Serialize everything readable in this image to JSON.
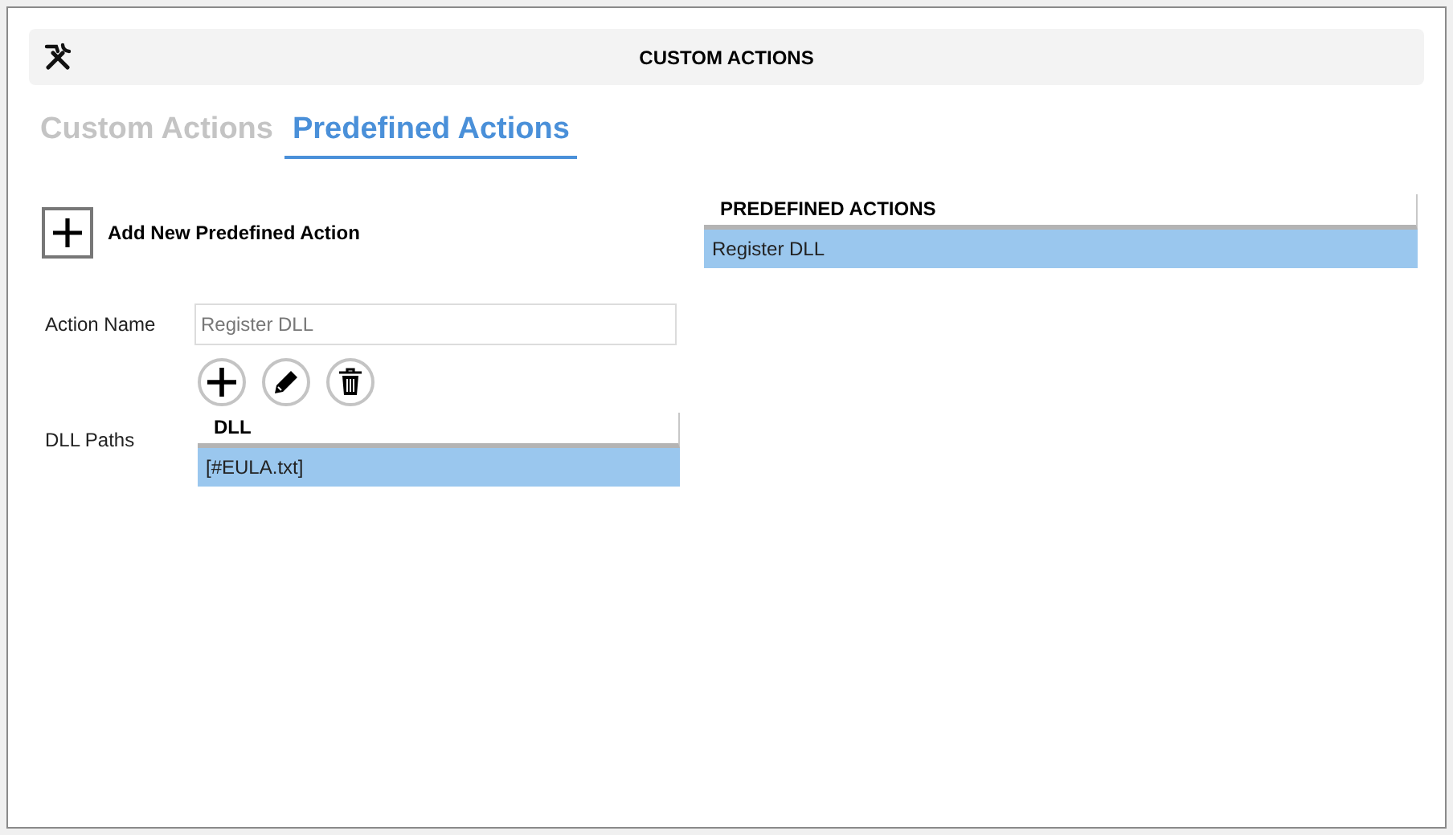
{
  "header": {
    "title": "CUSTOM ACTIONS"
  },
  "tabs": [
    {
      "label": "Custom Actions",
      "selected": false
    },
    {
      "label": "Predefined Actions",
      "selected": true
    }
  ],
  "add_button": {
    "label": "Add New Predefined Action"
  },
  "form": {
    "action_name": {
      "label": "Action Name",
      "value": "Register DLL"
    },
    "dll_paths": {
      "label": "DLL Paths",
      "column": "DLL",
      "rows": [
        {
          "text": "[#EULA.txt]",
          "selected": true
        }
      ]
    }
  },
  "predefined_actions": {
    "column": "PREDEFINED ACTIONS",
    "rows": [
      {
        "text": "Register DLL",
        "selected": true
      }
    ]
  }
}
